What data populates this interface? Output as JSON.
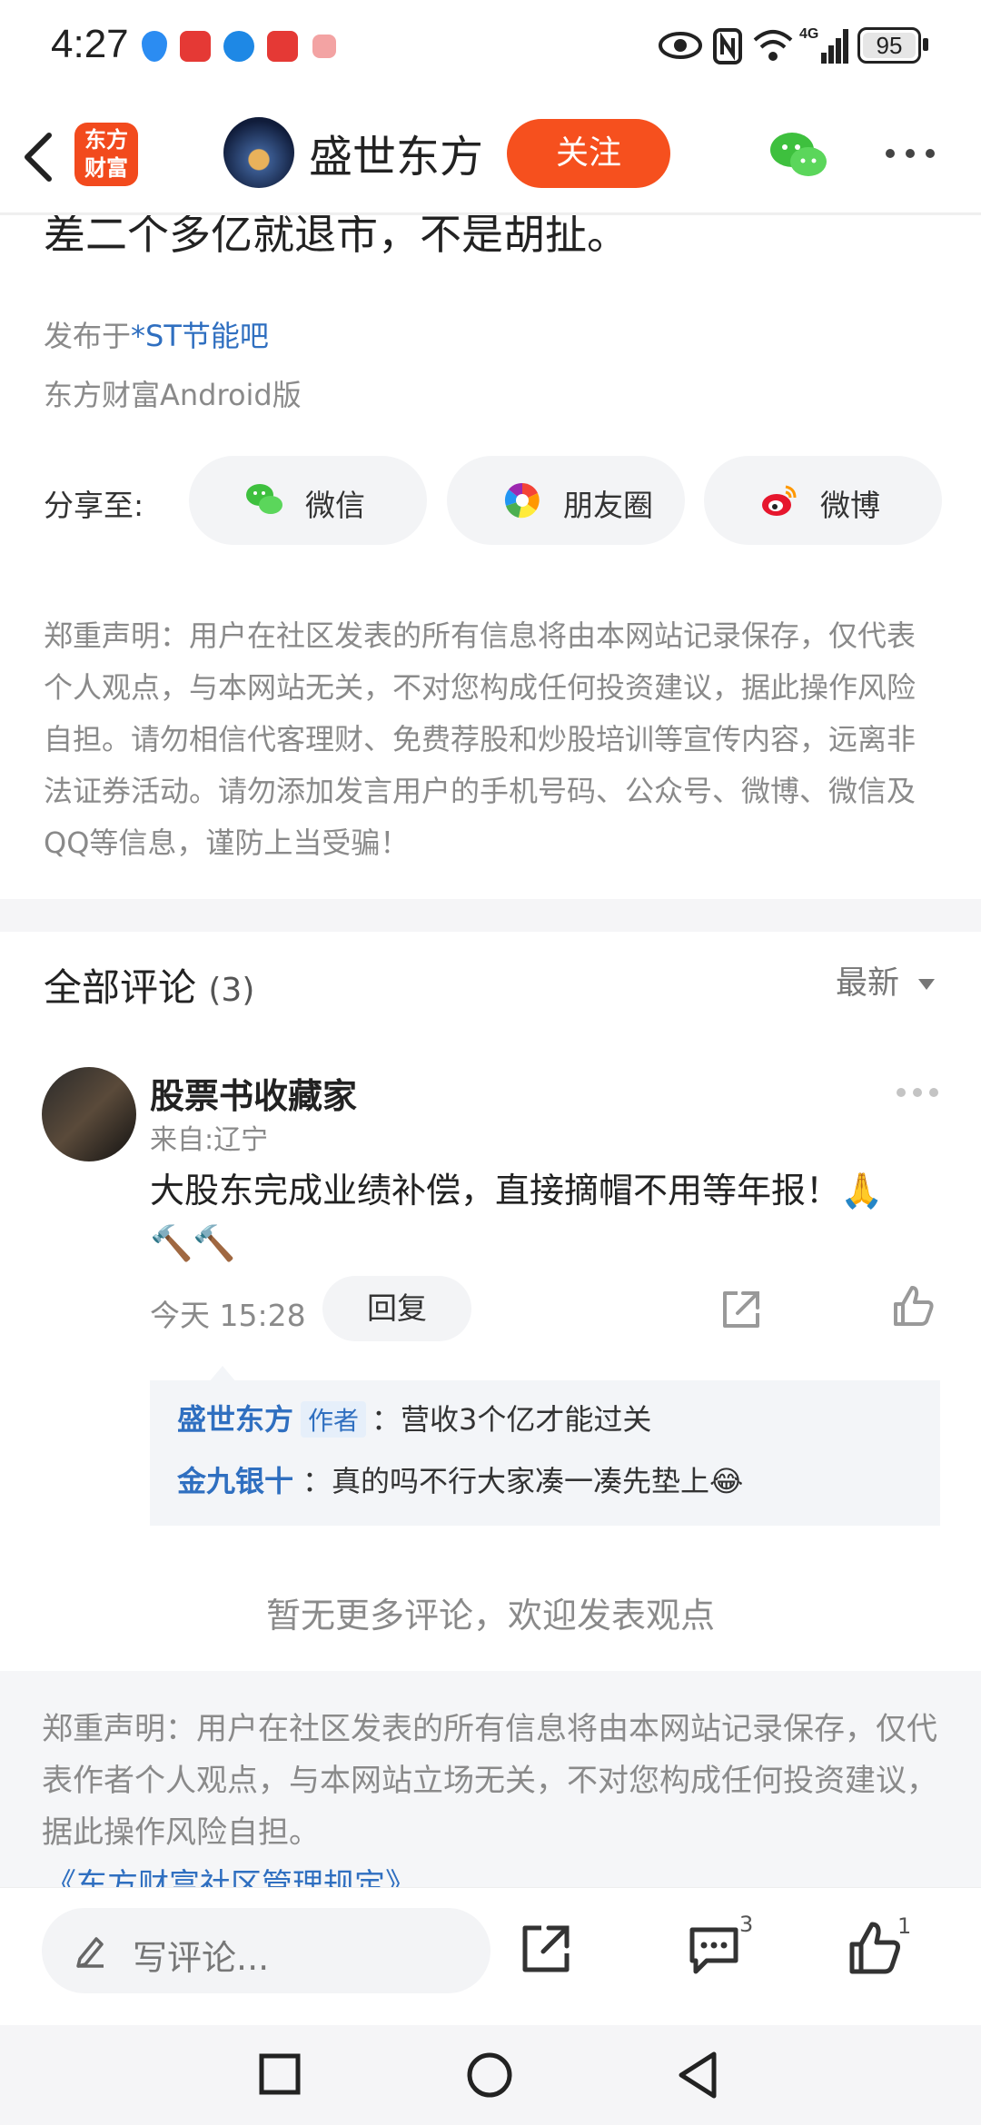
{
  "status_bar": {
    "time": "4:27",
    "battery": "95",
    "network": "4G"
  },
  "header": {
    "logo_line1": "东方",
    "logo_line2": "财富",
    "author_name": "盛世东方",
    "follow_label": "关注"
  },
  "post": {
    "tail_text": "差二个多亿就退市，不是胡扯。",
    "published_prefix": "发布于",
    "board": "*ST节能吧",
    "client": "东方财富Android版"
  },
  "share": {
    "label": "分享至:",
    "wechat": "微信",
    "moments": "朋友圈",
    "weibo": "微博"
  },
  "disclaimer_top": "郑重声明：用户在社区发表的所有信息将由本网站记录保存，仅代表个人观点，与本网站无关，不对您构成任何投资建议，据此操作风险自担。请勿相信代客理财、免费荐股和炒股培训等宣传内容，远离非法证券活动。请勿添加发言用户的手机号码、公众号、微博、微信及QQ等信息，谨防上当受骗！",
  "comments": {
    "title": "全部评论",
    "count": "(3)",
    "sort": "最新",
    "items": [
      {
        "user": "股票书收藏家",
        "location": "来自:辽宁",
        "text": "大股东完成业绩补偿，直接摘帽不用等年报！🙏🔨🔨",
        "time": "今天 15:28",
        "reply_label": "回复",
        "replies": [
          {
            "name": "盛世东方",
            "tag": "作者",
            "text": "：营收3个亿才能过关"
          },
          {
            "name": "金九银十",
            "tag": "",
            "text": "：真的吗不行大家凑一凑先垫上😂"
          }
        ]
      }
    ],
    "no_more": "暂无更多评论，欢迎发表观点"
  },
  "disclaimer_bottom": "郑重声明：用户在社区发表的所有信息将由本网站记录保存，仅代表作者个人观点，与本网站立场无关，不对您构成任何投资建议，据此操作风险自担。",
  "rules_link": "《东方财富社区管理规定》",
  "bottom_bar": {
    "comment_placeholder": "写评论...",
    "comment_count": "3",
    "like_count": "1"
  },
  "colors": {
    "accent": "#f6501e",
    "link": "#2f6fc0"
  }
}
